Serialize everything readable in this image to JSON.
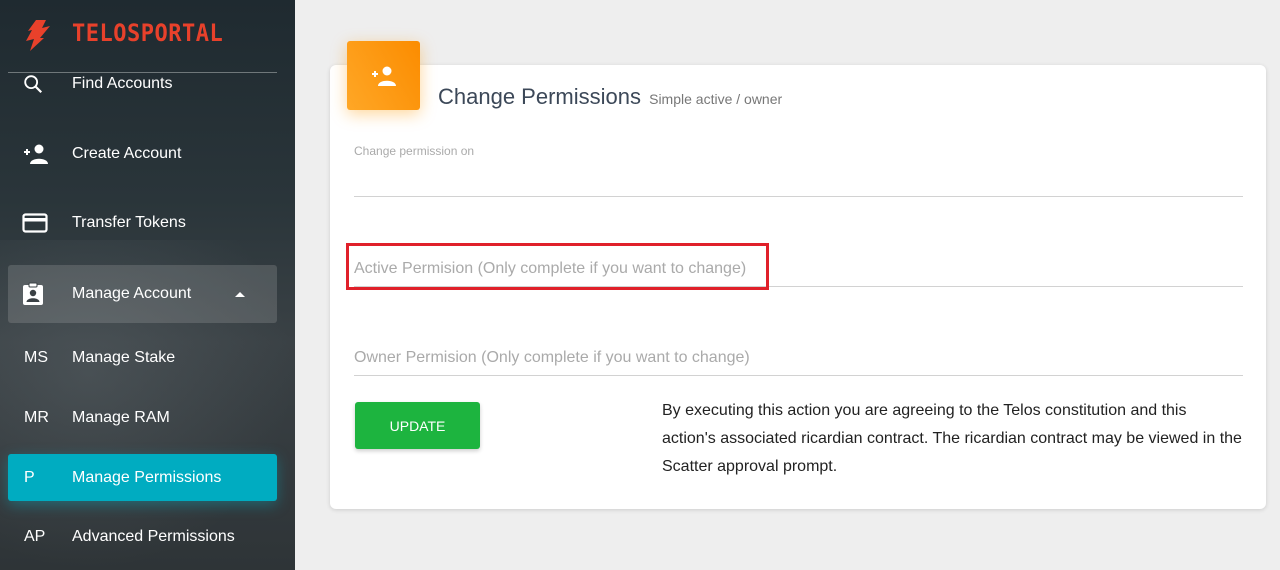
{
  "brand": {
    "name": "TELOSPORTAL",
    "color": "#e8412b"
  },
  "sidebar": {
    "items": [
      {
        "icon": "search-icon",
        "label": "Find Accounts"
      },
      {
        "icon": "person-add-icon",
        "label": "Create Account"
      },
      {
        "icon": "credit-card-icon",
        "label": "Transfer Tokens"
      },
      {
        "icon": "assignment-ind-icon",
        "label": "Manage Account",
        "expanded": true
      },
      {
        "abbr": "MS",
        "label": "Manage Stake"
      },
      {
        "abbr": "MR",
        "label": "Manage RAM"
      },
      {
        "abbr": "P",
        "label": "Manage Permissions",
        "active": true
      },
      {
        "abbr": "AP",
        "label": "Advanced Permissions"
      }
    ],
    "active_color": "#00acc1"
  },
  "card": {
    "icon": "person-add-icon",
    "title": "Change Permissions",
    "subtitle": "Simple active / owner",
    "field_change_on_label": "Change permission on",
    "active_placeholder": "Active Permision (Only complete if you want to change)",
    "owner_placeholder": "Owner Permision (Only complete if you want to change)",
    "update_label": "UPDATE",
    "disclaimer": "By executing this action you are agreeing to the Telos constitution and this action's associated ricardian contract. The ricardian contract may be viewed in the Scatter approval prompt."
  },
  "colors": {
    "accent_orange": "#fb8c00",
    "update_green": "#1db43f",
    "highlight_red": "#e0202a"
  }
}
